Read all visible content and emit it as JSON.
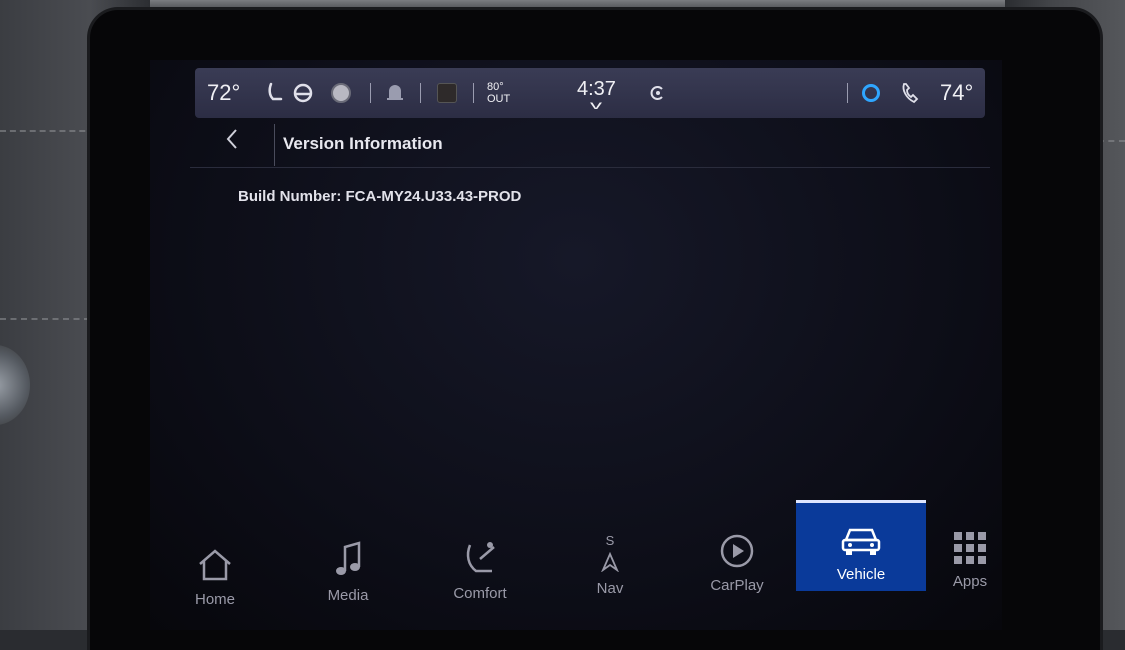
{
  "status_bar": {
    "driver_temp": "72°",
    "outside_temp": "80°",
    "outside_label": "OUT",
    "clock": "4:37",
    "passenger_temp": "74°"
  },
  "header": {
    "title": "Version Information"
  },
  "content": {
    "build_number": "Build Number: FCA-MY24.U33.43-PROD"
  },
  "nav": {
    "items": [
      {
        "label": "Home",
        "icon": "home-icon"
      },
      {
        "label": "Media",
        "icon": "music-note-icon"
      },
      {
        "label": "Comfort",
        "icon": "seat-icon"
      },
      {
        "label": "Nav",
        "icon": "compass-icon",
        "heading": "S"
      },
      {
        "label": "CarPlay",
        "icon": "play-icon"
      },
      {
        "label": "Vehicle",
        "icon": "car-icon"
      },
      {
        "label": "Apps",
        "icon": "grid-icon"
      }
    ],
    "active": "Vehicle"
  },
  "colors": {
    "active_tab": "#0a3a9a",
    "status_bar": "#33354d",
    "alexa_ring": "#2fa6ff"
  }
}
